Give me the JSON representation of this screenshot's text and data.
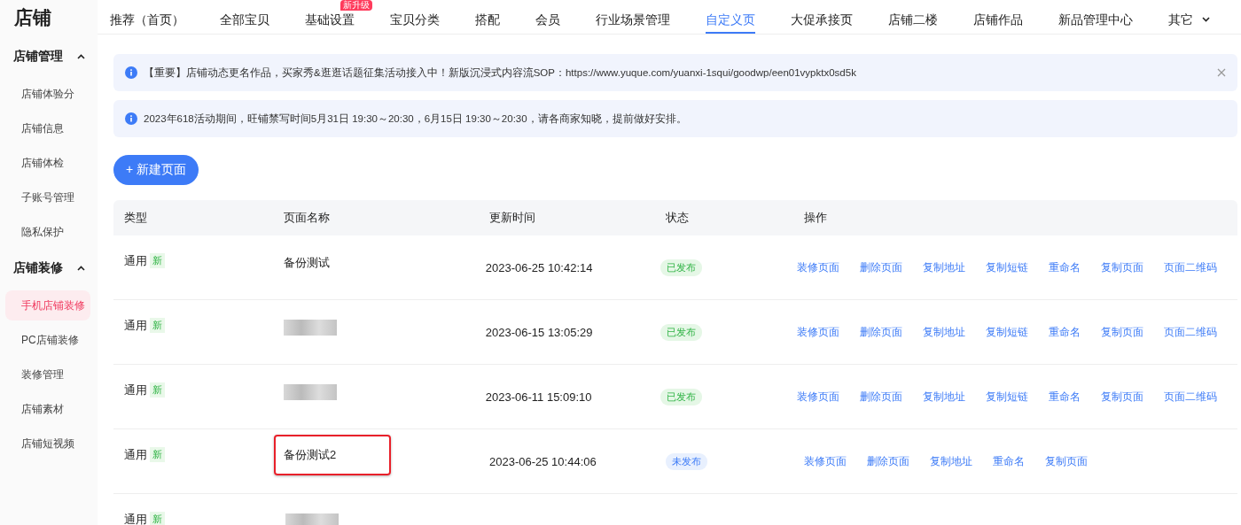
{
  "sidebar": {
    "title": "店铺",
    "groups": [
      {
        "label": "店铺管理",
        "expanded": true,
        "items": [
          {
            "label": "店铺体验分",
            "selected": false
          },
          {
            "label": "店铺信息",
            "selected": false
          },
          {
            "label": "店铺体检",
            "selected": false
          },
          {
            "label": "子账号管理",
            "selected": false
          },
          {
            "label": "隐私保护",
            "selected": false
          }
        ]
      },
      {
        "label": "店铺装修",
        "expanded": true,
        "items": [
          {
            "label": "手机店铺装修",
            "selected": true
          },
          {
            "label": "PC店铺装修",
            "selected": false
          },
          {
            "label": "装修管理",
            "selected": false
          },
          {
            "label": "店铺素材",
            "selected": false
          },
          {
            "label": "店铺短视频",
            "selected": false
          }
        ]
      }
    ]
  },
  "tabs": [
    {
      "label": "推荐（首页）",
      "selected": false
    },
    {
      "label": "全部宝贝",
      "selected": false
    },
    {
      "label": "基础设置",
      "selected": false,
      "badge": "新升级"
    },
    {
      "label": "宝贝分类",
      "selected": false
    },
    {
      "label": "搭配",
      "selected": false
    },
    {
      "label": "会员",
      "selected": false
    },
    {
      "label": "行业场景管理",
      "selected": false
    },
    {
      "label": "自定义页",
      "selected": true
    },
    {
      "label": "大促承接页",
      "selected": false
    },
    {
      "label": "店铺二楼",
      "selected": false
    },
    {
      "label": "店铺作品",
      "selected": false
    },
    {
      "label": "新品管理中心",
      "selected": false
    },
    {
      "label": "其它",
      "selected": false,
      "dropdown": true
    }
  ],
  "notices": [
    {
      "text": "【重要】店铺动态更名作品，买家秀&逛逛话题征集活动接入中！新版沉浸式内容流SOP：https://www.yuque.com/yuanxi-1squi/goodwp/een01vypktx0sd5k",
      "closable": true
    },
    {
      "text": "2023年618活动期间，旺铺禁写时间5月31日 19:30～20:30，6月15日 19:30～20:30，请各商家知晓，提前做好安排。",
      "closable": false
    }
  ],
  "new_page_button": "+ 新建页面",
  "table": {
    "columns": [
      "类型",
      "页面名称",
      "更新时间",
      "状态",
      "操作"
    ],
    "rows": [
      {
        "type": "通用",
        "tag": "新",
        "name": "备份测试",
        "highlighted": false,
        "updated": "2023-06-25 10:42:14",
        "status": "已发布",
        "published": true,
        "actions": [
          "装修页面",
          "删除页面",
          "复制地址",
          "复制短链",
          "重命名",
          "复制页面",
          "页面二维码"
        ]
      },
      {
        "type": "通用",
        "tag": "新",
        "highlighted": false,
        "updated": "2023-06-15 13:05:29",
        "status": "已发布",
        "published": true,
        "actions": [
          "装修页面",
          "删除页面",
          "复制地址",
          "复制短链",
          "重命名",
          "复制页面",
          "页面二维码"
        ]
      },
      {
        "type": "通用",
        "tag": "新",
        "highlighted": false,
        "updated": "2023-06-11 15:09:10",
        "status": "已发布",
        "published": true,
        "actions": [
          "装修页面",
          "删除页面",
          "复制地址",
          "复制短链",
          "重命名",
          "复制页面",
          "页面二维码"
        ]
      },
      {
        "type": "通用",
        "tag": "新",
        "name": "备份测试2",
        "highlighted": true,
        "updated": "2023-06-25 10:44:06",
        "status": "未发布",
        "published": false,
        "actions": [
          "装修页面",
          "删除页面",
          "复制地址",
          "重命名",
          "复制页面"
        ]
      },
      {
        "type": "通用",
        "tag": "新"
      }
    ]
  }
}
